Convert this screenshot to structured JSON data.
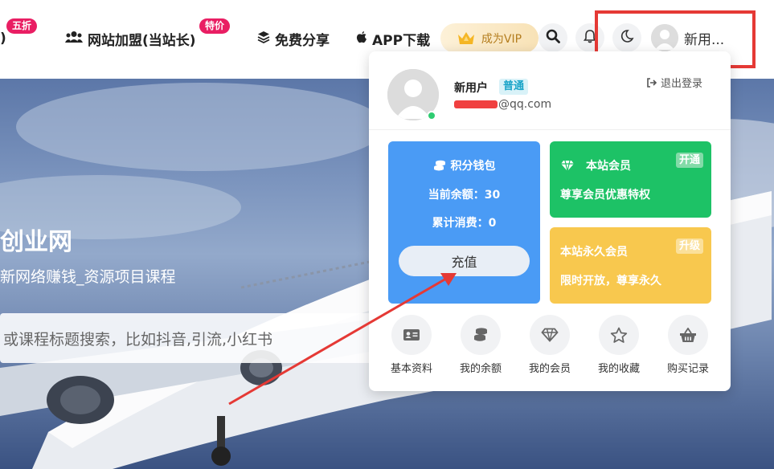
{
  "nav": {
    "item_partial_label": ")",
    "badge_half_price": "五折",
    "item_join": "网站加盟(当站长)",
    "badge_special": "特价",
    "item_share": "免费分享",
    "item_app": "APP下载",
    "vip_label": "成为VIP",
    "user_name": "新用..."
  },
  "hero": {
    "title": "创业网",
    "subtitle": "新网络赚钱_资源项目课程",
    "search_placeholder": "或课程标题搜索，比如抖音,引流,小红书"
  },
  "panel": {
    "user_name": "新用户",
    "level": "普通",
    "email": "@qq.com",
    "logout": "退出登录",
    "wallet": {
      "title": "积分钱包",
      "balance": "当前余额：30",
      "spent": "累计消费：0",
      "topup": "充值"
    },
    "member": {
      "title": "本站会员",
      "desc": "尊享会员优惠特权",
      "tag": "开通"
    },
    "lifetime": {
      "title": "本站永久会员",
      "desc": "限时开放，尊享永久",
      "tag": "升级"
    },
    "quick_links": [
      {
        "label": "基本资料",
        "icon": "id-card-icon"
      },
      {
        "label": "我的余额",
        "icon": "coins-icon"
      },
      {
        "label": "我的会员",
        "icon": "diamond-icon"
      },
      {
        "label": "我的收藏",
        "icon": "star-icon"
      },
      {
        "label": "购买记录",
        "icon": "basket-icon"
      }
    ]
  },
  "colors": {
    "wallet": "#4a9bf5",
    "member": "#1dc266",
    "lifetime": "#f8c84e",
    "badge": "#e91e63",
    "highlight": "#e53935"
  }
}
